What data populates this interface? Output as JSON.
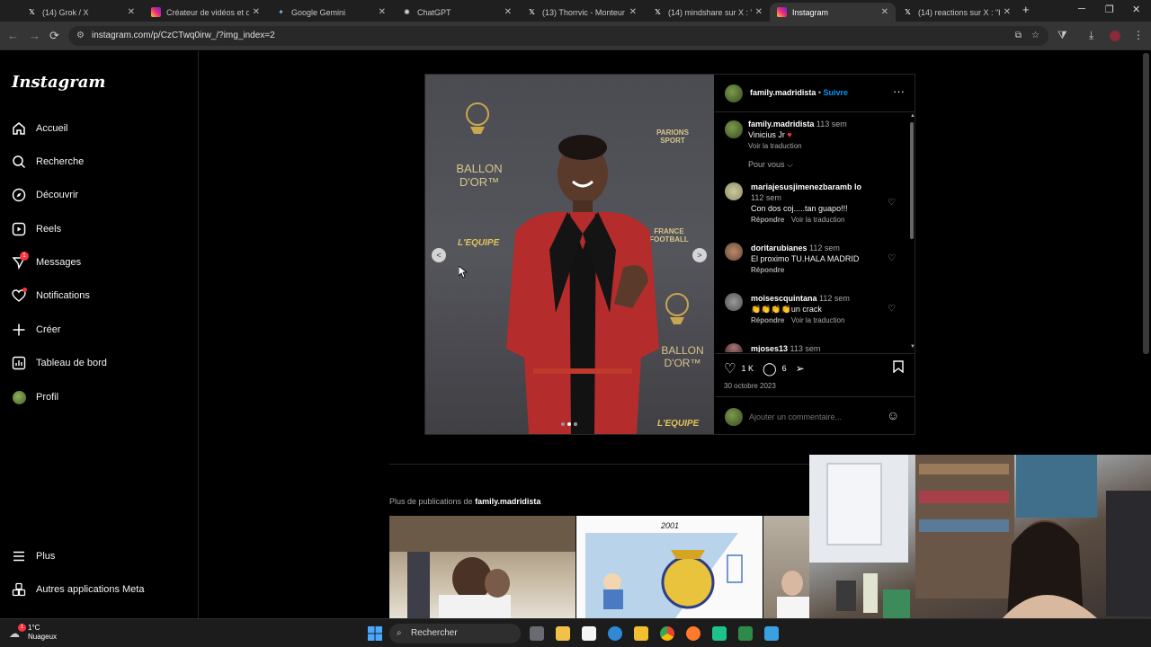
{
  "browser": {
    "tabs": [
      {
        "label": "(14) Grok / X",
        "icon": "x-logo-icon"
      },
      {
        "label": "Créateur de vidéos et d'i",
        "icon": "instagram-logo-icon"
      },
      {
        "label": "Google Gemini",
        "icon": "gemini-icon"
      },
      {
        "label": "ChatGPT",
        "icon": "chatgpt-icon"
      },
      {
        "label": "(13) Thorrvic - Monteur V",
        "icon": "x-logo-icon"
      },
      {
        "label": "(14) mindshare sur X : \"be",
        "icon": "x-logo-icon"
      },
      {
        "label": "Instagram",
        "icon": "instagram-logo-icon",
        "active": true
      },
      {
        "label": "(14) reactions sur X : \"bar",
        "icon": "x-logo-icon"
      }
    ],
    "url": "instagram.com/p/CzCTwq0irw_/?img_index=2"
  },
  "sidebar": {
    "logo": "Instagram",
    "items": [
      {
        "label": "Accueil",
        "icon": "home-icon"
      },
      {
        "label": "Recherche",
        "icon": "search-icon"
      },
      {
        "label": "Découvrir",
        "icon": "compass-icon"
      },
      {
        "label": "Reels",
        "icon": "reels-icon"
      },
      {
        "label": "Messages",
        "icon": "messenger-icon",
        "badge": "1"
      },
      {
        "label": "Notifications",
        "icon": "heart-icon"
      },
      {
        "label": "Créer",
        "icon": "plus-icon"
      },
      {
        "label": "Tableau de bord",
        "icon": "dashboard-icon"
      },
      {
        "label": "Profil",
        "icon": "avatar"
      }
    ],
    "bottom": [
      {
        "label": "Plus",
        "icon": "menu-icon"
      },
      {
        "label": "Autres applications Meta",
        "icon": "meta-apps-icon"
      }
    ]
  },
  "post": {
    "author": "family.madridista",
    "follow": "Suivre",
    "separator": "•",
    "caption": {
      "user": "family.madridista",
      "time": "113 sem",
      "text": "Vinicius Jr",
      "translate": "Voir la traduction"
    },
    "sort_label": "Pour vous",
    "comments": [
      {
        "user": "mariajesusjimenezbaramb lo",
        "time": "112 sem",
        "text": "Con dos coj.....tan guapo!!!",
        "reply": "Répondre",
        "translate": "Voir la traduction"
      },
      {
        "user": "doritarubianes",
        "time": "112 sem",
        "text": "El proximo TU.HALA MADRID",
        "reply": "Répondre",
        "translate": ""
      },
      {
        "user": "moisescquintana",
        "time": "112 sem",
        "text": "👏👏👏👏un crack",
        "reply": "Répondre",
        "translate": "Voir la traduction"
      },
      {
        "user": "mjoses13",
        "time": "113 sem",
        "text": "",
        "reply": "",
        "translate": ""
      }
    ],
    "likes": "1 K",
    "comments_count": "6",
    "date": "30 octobre 2023",
    "add_comment_placeholder": "Ajouter un commentaire...",
    "photo_text": {
      "ballon1": "BALLON D'OR™",
      "ballon2": "BALLON D'OR™",
      "parions": "PARIONS SPORT",
      "lequipe1": "L'EQUIPE",
      "lequipe2": "L'EQUIPE",
      "ff": "FRANCE FOOTBALL"
    },
    "carousel": {
      "count": 3,
      "active_index": 2
    }
  },
  "more_posts": {
    "label_prefix": "Plus de publications de",
    "label_user": "family.madridista",
    "thumb_year": "2001"
  },
  "taskbar": {
    "weather_temp": "1°C",
    "weather_desc": "Nuageux",
    "weather_badge": "1",
    "search_placeholder": "Rechercher"
  },
  "colors": {
    "accent_blue": "#0095f6",
    "badge_red": "#ff3040",
    "jacket_red": "#b52c2c"
  }
}
